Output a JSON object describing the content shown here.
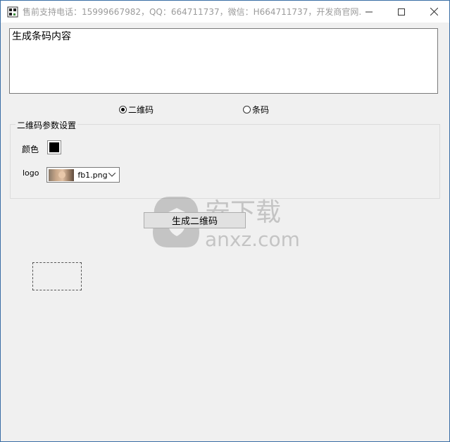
{
  "window": {
    "title": "售前支持电话：15999667982，QQ：664711737，微信：H664711737，开发商官网...",
    "minimize": "—",
    "maximize": "☐",
    "close": "✕"
  },
  "content": {
    "text_value": "生成条码内容"
  },
  "mode": {
    "options": [
      {
        "label": "二维码",
        "checked": true
      },
      {
        "label": "条码",
        "checked": false
      }
    ]
  },
  "qr_settings": {
    "group_title": "二维码参数设置",
    "color_label": "颜色",
    "color_value": "#000000",
    "logo_label": "logo",
    "logo_selected": "fb1.png"
  },
  "actions": {
    "generate_label": "生成二维码"
  },
  "watermark": {
    "text": "anxz.com",
    "cn": "安下载"
  }
}
